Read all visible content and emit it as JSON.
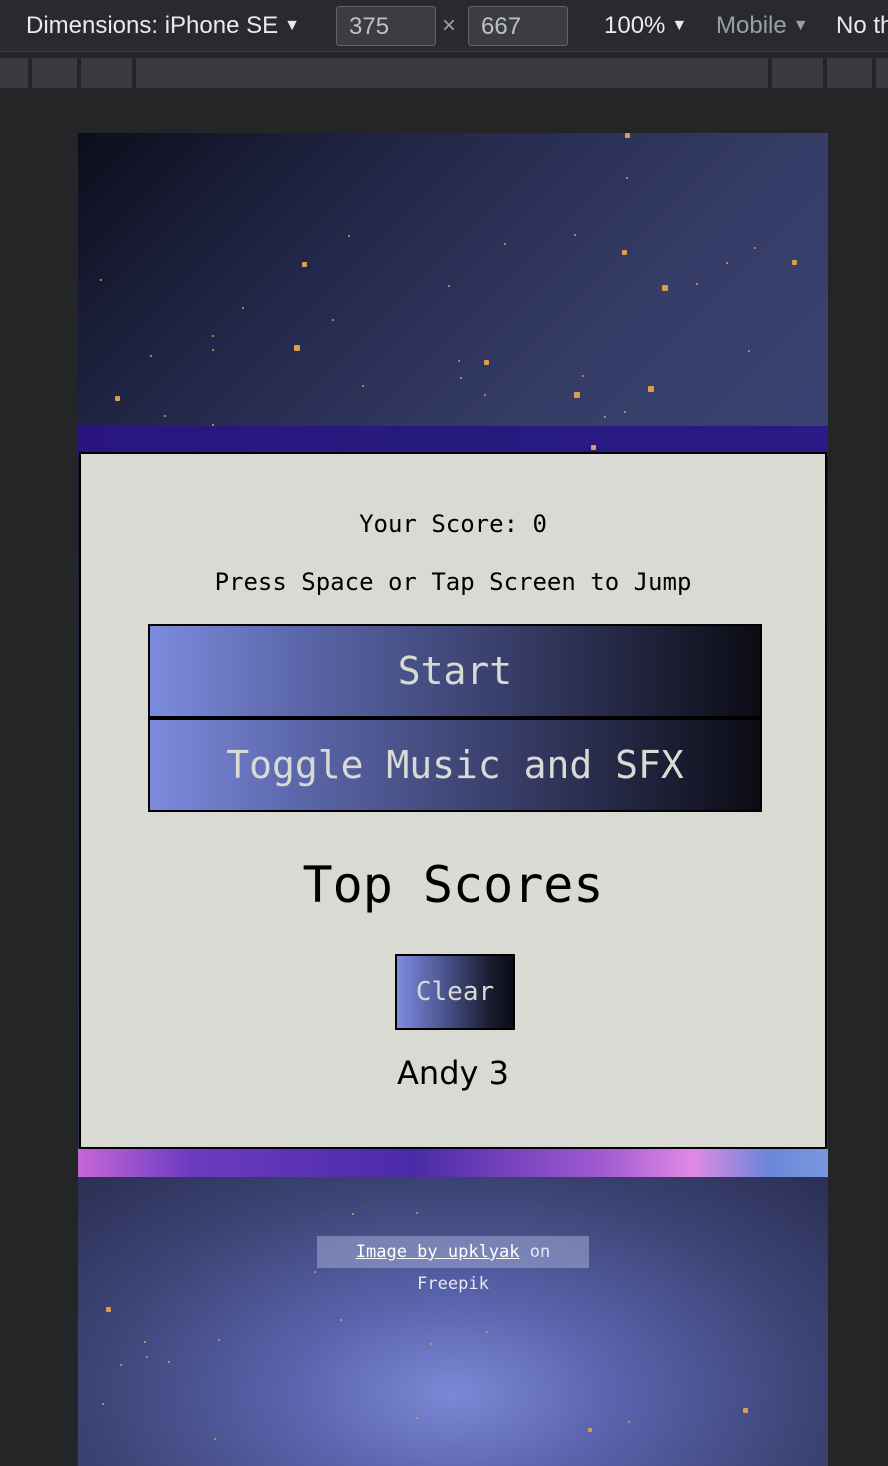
{
  "devtools": {
    "dimensions_label": "Dimensions: iPhone SE",
    "width_value": "375",
    "times": "×",
    "height_value": "667",
    "zoom": "100%",
    "mode": "Mobile",
    "throttle": "No th",
    "caret": "▼"
  },
  "game": {
    "score_text": "Your Score: 0",
    "hint_text": "Press Space or Tap Screen to Jump",
    "start_label": "Start",
    "toggle_label": "Toggle Music and SFX",
    "top_scores_title": "Top Scores",
    "clear_label": "Clear",
    "scores": [
      "Andy 3"
    ]
  },
  "credit": {
    "link_text": "Image by upklyak",
    "suffix": "on Freepik"
  },
  "colors": {
    "panel_bg": "#d9dad3",
    "button_gradient_start": "#7d8bdf",
    "button_gradient_end": "#0b0b14",
    "star": "#d99e4f"
  }
}
